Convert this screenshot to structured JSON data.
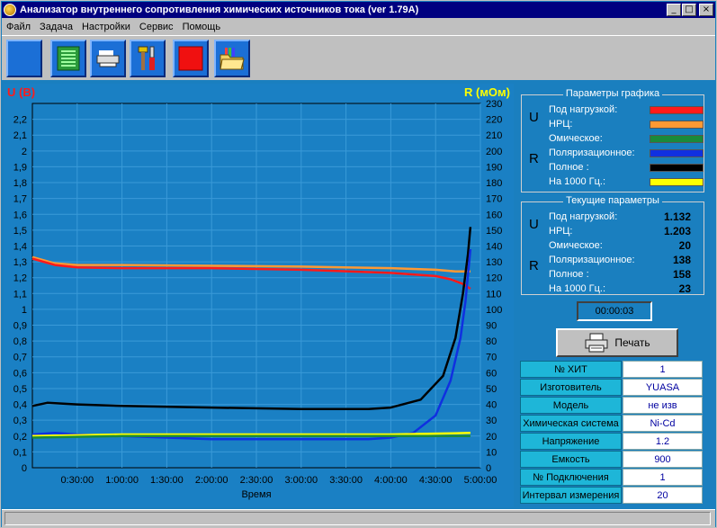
{
  "window": {
    "title": "Анализатор внутреннего сопротивления химических источников тока (ver 1.79A)",
    "controls": [
      "_",
      "□",
      "×"
    ]
  },
  "menu": [
    "Файл",
    "Задача",
    "Настройки",
    "Сервис",
    "Помощь"
  ],
  "toolbar": [
    "blank-tool",
    "list-icon",
    "printer-tray-icon",
    "tools-icon",
    "stop-icon",
    "folder-open-icon"
  ],
  "colors": {
    "u_load": "#ff1a1a",
    "u_npc": "#ff9933",
    "r_ohmic": "#1a8a3a",
    "r_polar": "#1030e0",
    "r_total": "#000000",
    "r_1000": "#ffff00"
  },
  "chart_data": {
    "type": "line",
    "xlabel": "Время",
    "ylabel_left": "U (В)",
    "ylabel_right": "R (мОм)",
    "xlim": [
      0,
      18000
    ],
    "ylim_left": [
      0,
      2.3
    ],
    "ylim_right": [
      0,
      230
    ],
    "x_ticks": [
      "0:30:00",
      "1:00:00",
      "1:30:00",
      "2:00:00",
      "2:30:00",
      "3:00:00",
      "3:30:00",
      "4:00:00",
      "4:30:00",
      "5:00:00"
    ],
    "y_ticks_left": [
      "0",
      "0,1",
      "0,2",
      "0,3",
      "0,4",
      "0,5",
      "0,6",
      "0,7",
      "0,8",
      "0,9",
      "1",
      "1,1",
      "1,2",
      "1,3",
      "1,4",
      "1,5",
      "1,6",
      "1,7",
      "1,8",
      "1,9",
      "2",
      "2,1",
      "2,2"
    ],
    "y_ticks_right": [
      "0",
      "10",
      "20",
      "30",
      "40",
      "50",
      "60",
      "70",
      "80",
      "90",
      "100",
      "110",
      "120",
      "130",
      "140",
      "150",
      "160",
      "170",
      "180",
      "190",
      "200",
      "210",
      "220",
      "230"
    ],
    "grid": true,
    "series": [
      {
        "name": "НРЦ",
        "axis": "left",
        "color": "#ff9933",
        "x": [
          0,
          900,
          1800,
          3600,
          7200,
          10800,
          14400,
          16200,
          17000,
          17600
        ],
        "y": [
          1.33,
          1.29,
          1.28,
          1.28,
          1.275,
          1.27,
          1.26,
          1.25,
          1.24,
          1.24
        ]
      },
      {
        "name": "Под нагрузкой",
        "axis": "left",
        "color": "#ff1a1a",
        "x": [
          0,
          900,
          1800,
          3600,
          7200,
          10800,
          14400,
          16200,
          16800,
          17300,
          17600
        ],
        "y": [
          1.32,
          1.28,
          1.265,
          1.26,
          1.26,
          1.25,
          1.23,
          1.21,
          1.19,
          1.16,
          1.13
        ]
      },
      {
        "name": "Полное",
        "axis": "right",
        "color": "#000000",
        "x": [
          0,
          600,
          1800,
          3600,
          7200,
          10800,
          13500,
          14400,
          15600,
          16500,
          17000,
          17300,
          17500,
          17600
        ],
        "y": [
          39,
          41,
          40,
          39,
          38,
          37,
          37,
          38,
          43,
          58,
          82,
          110,
          135,
          152
        ]
      },
      {
        "name": "Поляризационное",
        "axis": "right",
        "color": "#1030e0",
        "x": [
          0,
          900,
          1800,
          3600,
          5400,
          7200,
          10800,
          13500,
          14400,
          15300,
          16200,
          16800,
          17200,
          17400,
          17600
        ],
        "y": [
          21,
          22,
          21,
          20,
          19,
          18,
          18,
          18,
          19,
          22,
          33,
          55,
          82,
          105,
          138
        ]
      },
      {
        "name": "На 1000 Гц.",
        "axis": "right",
        "color": "#ffff00",
        "x": [
          0,
          3600,
          7200,
          10800,
          14400,
          17600
        ],
        "y": [
          20,
          21,
          21,
          21,
          21,
          22
        ]
      },
      {
        "name": "Омическое",
        "axis": "right",
        "color": "#1a8a3a",
        "x": [
          0,
          3600,
          7200,
          10800,
          14400,
          17600
        ],
        "y": [
          19,
          20,
          20,
          20,
          20,
          20
        ]
      }
    ]
  },
  "graph_params": {
    "title": "Параметры графика",
    "u_label": "U",
    "r_label": "R",
    "u_items": [
      {
        "label": "Под нагрузкой:",
        "color": "#ff1a1a"
      },
      {
        "label": "НРЦ:",
        "color": "#ff9933"
      }
    ],
    "r_items": [
      {
        "label": "Омическое:",
        "color": "#1a8a3a"
      },
      {
        "label": "Поляризационное:",
        "color": "#1030e0"
      },
      {
        "label": "Полное :",
        "color": "#000000"
      },
      {
        "label": "На 1000 Гц.:",
        "color": "#ffff00"
      }
    ]
  },
  "current_params": {
    "title": "Текущие параметры",
    "u_label": "U",
    "r_label": "R",
    "u_items": [
      {
        "label": "Под нагрузкой:",
        "value": "1.132"
      },
      {
        "label": "НРЦ:",
        "value": "1.203"
      }
    ],
    "r_items": [
      {
        "label": "Омическое:",
        "value": "20"
      },
      {
        "label": "Поляризационное:",
        "value": "138"
      },
      {
        "label": "Полное :",
        "value": "158"
      },
      {
        "label": "На 1000 Гц.:",
        "value": "23"
      }
    ]
  },
  "timer": "00:00:03",
  "print_button": "Печать",
  "info": [
    {
      "key": "№ ХИТ",
      "value": "1"
    },
    {
      "key": "Изготовитель",
      "value": "YUASA"
    },
    {
      "key": "Модель",
      "value": "не изв"
    },
    {
      "key": "Химическая система",
      "value": "Ni-Cd"
    },
    {
      "key": "Напряжение",
      "value": "1.2"
    },
    {
      "key": "Емкость",
      "value": "900"
    },
    {
      "key": "№ Подключения",
      "value": "1"
    },
    {
      "key": "Интервал измерения",
      "value": "20"
    }
  ]
}
